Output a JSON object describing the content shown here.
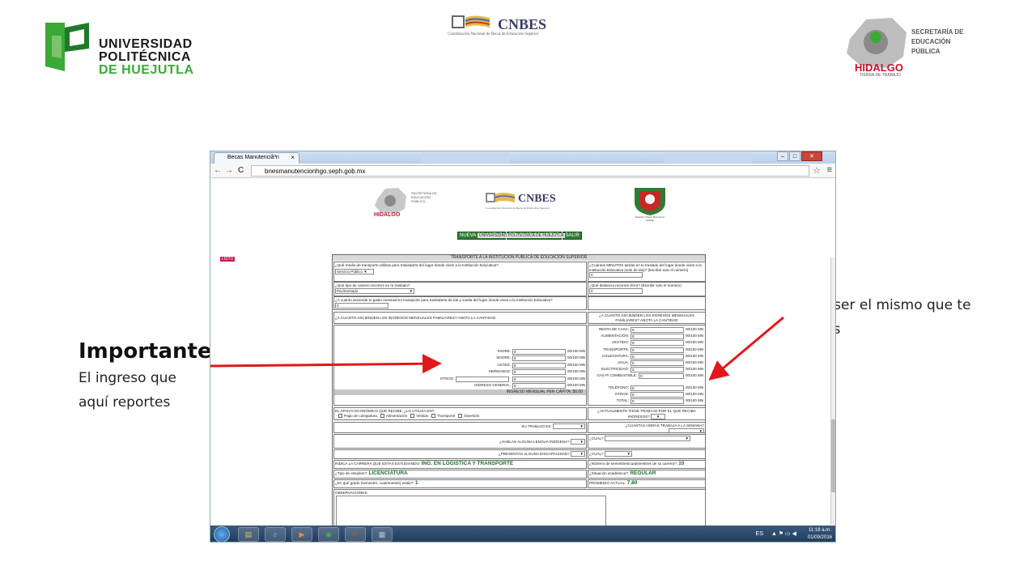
{
  "slide": {
    "upl": {
      "line1": "UNIVERSIDAD",
      "line2": "POLITÉCNICA",
      "line3": "DE HUEJUTLA"
    },
    "cnbes": {
      "name": "CNBES",
      "sub": "Coordinación Nacional de Becas de Educación Superior"
    },
    "seph": {
      "l1": "SECRETARÍA DE",
      "l2": "EDUCACIÓN",
      "l3": "PÚBLICA",
      "hidalgo": "HIDALGO",
      "tierra": "TIERRA DE TRABAJO"
    },
    "note_right": {
      "l1": "Debe ser el mismo que te",
      "l2": "Gastes"
    },
    "note_left": {
      "title": "Importante",
      "l1": "El ingreso que",
      "l2": "aquí reportes"
    },
    "arrow_color": "#e0181b"
  },
  "browser": {
    "tab_title": "Becas Manutenciâ³n",
    "tab_close": "×",
    "url": "bnesmanutencionhgo.seph.gob.mx",
    "back": "←",
    "forward": "→",
    "reload": "C",
    "star": "☆",
    "menu": "≡",
    "win_min": "–",
    "win_max": "□",
    "win_close": "✕"
  },
  "webpage": {
    "seph_small": {
      "hidalgo": "HIDALGO",
      "text": "SECRETARÍA DE EDUCACIÓN PÚBLICA"
    },
    "cnbes_small": {
      "name": "CNBES",
      "sub": "Coordinación Nacional de Becas de Educación Superior"
    },
    "shield_caption": "Estados Unidos Mexicanos Hidalgo",
    "menu": {
      "new": "NUEVA SOLICITUD",
      "renew": "RENOVAR SOLICITUD",
      "exit": "SALIR"
    },
    "university": "UNIVERSIDAD POLITECNICA DE HUEJUTLA",
    "listo": "LISTO",
    "form": {
      "section_title": "TRANSPORTE A LA INSTITUCION PUBLICA DE EDUCACION SUPERIOR",
      "q_transport": "¿Qué medio de transporte utilizas para trasladarte del lugar donde vives a la Institución Educativa?",
      "transport_value": "Servicio Público",
      "q_minutes": "¿Cuántos MINUTOS tardas en tu traslado del lugar donde vives a la Institución Educativa (solo de ida)? (Escribir solo el número)",
      "minutes_value": "0",
      "q_road": "¿Qué tipo de camino recorres en tu traslado?",
      "road_value": "Pavimentado",
      "q_distance": "¿Qué distancia recorres (Km)? (Escribir solo el número)",
      "distance_value": "0",
      "q_spending": "¿A cuánto asciende tu gasto mensual en transporte para trasladarte de ida y vuelta del lugar donde vives a la Institución Educativa?",
      "spending_value": "0",
      "income_title": "¿A CUANTO ASCIENDEN LOS INGRESOS MENSUALES FAMILIARES? ANOTA LA CANTIDAD",
      "expense_title": "¿A CUANTO ASCIENDEN LOS EGRESOS MENSUALES FAMILIARES? ANOTA LA CANTIDAD",
      "income_rows": [
        {
          "label": "PADRE:",
          "value": "0",
          "unit": "00/100 MN"
        },
        {
          "label": "MADRE:",
          "value": "0",
          "unit": "00/100 MN"
        },
        {
          "label": "USTED:",
          "value": "0",
          "unit": "00/100 MN"
        },
        {
          "label": "HERMANOS:",
          "value": "0",
          "unit": "00/100 MN"
        },
        {
          "label": "OTROS:",
          "value": "0",
          "unit": "00/100 MN"
        },
        {
          "label": "INGRESO GENERAL:",
          "value": "0",
          "unit": "00/100 MN"
        }
      ],
      "per_capita": "INGRESO MENSUAL PER CÁPITA: $0.00",
      "expense_rows": [
        {
          "label": "RENTA DE CASA:",
          "value": "0",
          "unit": "00/100 MN"
        },
        {
          "label": "ALIMENTACIÓN:",
          "value": "0",
          "unit": "00/100 MN"
        },
        {
          "label": "VESTIDO:",
          "value": "0",
          "unit": "00/100 MN"
        },
        {
          "label": "TRANSPORTE:",
          "value": "0",
          "unit": "00/100 MN"
        },
        {
          "label": "COLEGIATURA:",
          "value": "0",
          "unit": "00/100 MN"
        },
        {
          "label": "AGUA:",
          "value": "0",
          "unit": "00/100 MN"
        },
        {
          "label": "ELECTRICIDAD:",
          "value": "0",
          "unit": "00/100 MN"
        },
        {
          "label": "GAS P/ COMBUSTIBLE:",
          "value": "0",
          "unit": "00/100 MN"
        },
        {
          "label": "TELÉFONO:",
          "value": "0",
          "unit": "00/100 MN"
        },
        {
          "label": "OTROS:",
          "value": "0",
          "unit": "00/100 MN"
        },
        {
          "label": "TOTAL:",
          "value": "0",
          "unit": "00/100 MN"
        }
      ],
      "q_support": "EL APOYO ECONÓMICO QUE RECIBE, ¿LO UTILIZA EN?",
      "support_opts": [
        "Pago de colegiatura",
        "Alimentación",
        "Vestido",
        "Transporte",
        "Diversión"
      ],
      "q_job": "¿ACTUALMENTE TIENE TRABAJO POR EL QUE RECIBA INGRESOS?",
      "q_job_type": "SU TRABAJO ES:",
      "q_hours": "¿CUANTAS HORAS TRABAJA A LA SEMANA?",
      "q_indigenous": "¿HABLAS ALGUNA LENGUA INDÍGENA?",
      "q_which1": "¿CUÁL?",
      "q_disability": "¿PRESENTAS ALGUNA DISCAPACIDAD?",
      "q_which2": "¿CUÁL?",
      "q_career": "INDICA LA CARRERA QUE ESTAS ESTUDIANDO:",
      "career_value": "ING. EN LOGISTICA Y TRANSPORTE",
      "q_semesters": "¿Número de semestres/cuatrimestres de su carrera?:",
      "semesters_value": "10",
      "q_study_type": "¿Tipo de estudios?:",
      "study_type_value": "LICENCIATURA",
      "q_status": "¿Situación académica?:",
      "status_value": "REGULAR",
      "q_grade": "¿En qué grado (semestre, cuatrimestre) estás?:",
      "grade_value": "1",
      "q_average": "PROMEDIO ACTUAL:",
      "average_value": "7.80",
      "observations": "OBSERVACIONES:"
    }
  },
  "taskbar": {
    "lang": "ES",
    "time": "11:18 a.m.",
    "date": "01/09/2016",
    "icons": [
      "explorer-icon",
      "ie-icon",
      "media-player-icon",
      "chrome-icon",
      "powerpoint-icon",
      "document-icon"
    ]
  }
}
